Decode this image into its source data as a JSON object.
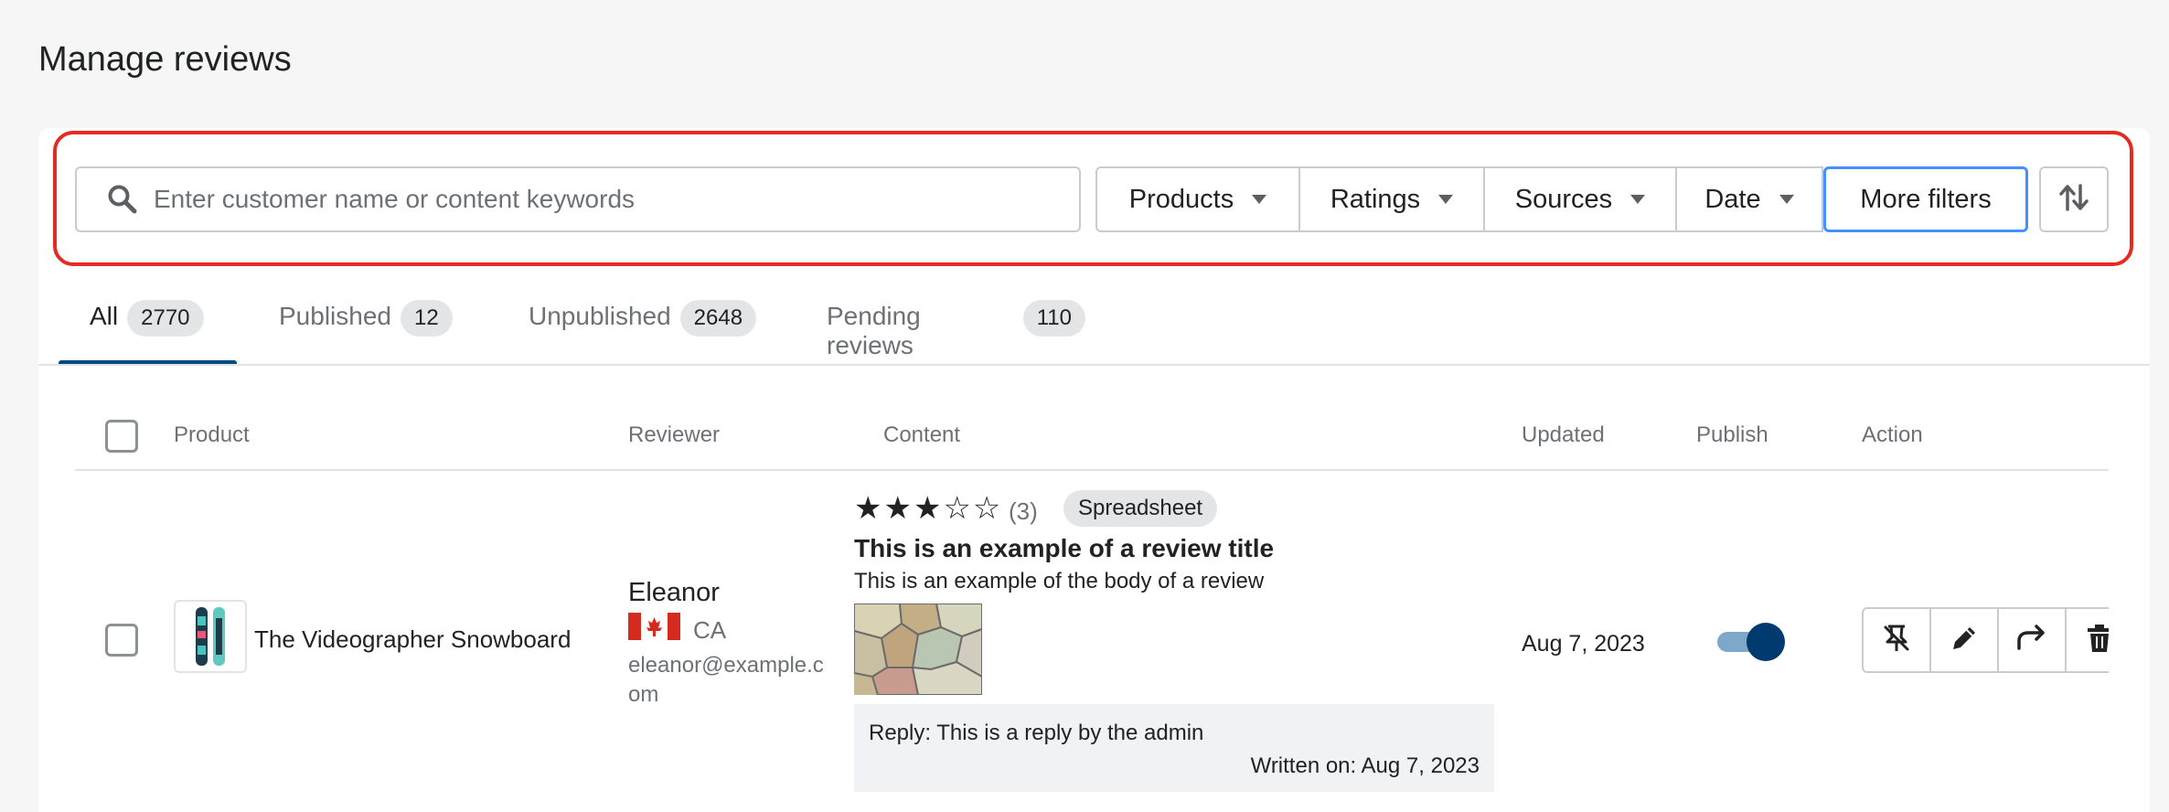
{
  "page": {
    "title": "Manage reviews"
  },
  "search": {
    "placeholder": "Enter customer name or content keywords"
  },
  "filters": {
    "products": "Products",
    "ratings": "Ratings",
    "sources": "Sources",
    "date": "Date",
    "more": "More filters"
  },
  "tabs": [
    {
      "label": "All",
      "count": "2770",
      "active": true
    },
    {
      "label": "Published",
      "count": "12"
    },
    {
      "label": "Unpublished",
      "count": "2648"
    },
    {
      "label": "Pending reviews",
      "count": "110"
    }
  ],
  "table": {
    "columns": [
      "Product",
      "Reviewer",
      "Content",
      "Updated",
      "Publish",
      "Action"
    ],
    "rows": [
      {
        "product": "The Videographer Snowboard",
        "reviewer": {
          "name": "Eleanor",
          "country": "CA",
          "email": "eleanor@example.com"
        },
        "rating_stars": "★★★☆☆",
        "rating_count": "(3)",
        "source": "Spreadsheet",
        "title": "This is an example of a review title",
        "body": "This is an example of the body of a review",
        "reply": "Reply: This is a reply by the admin",
        "reply_date": "Written on: Aug 7, 2023",
        "updated": "Aug 7, 2023",
        "published": true
      }
    ]
  },
  "icons": {
    "search": "search-icon",
    "caret": "caret-down-icon",
    "sort": "sort-icon",
    "flag": "canada-flag-icon",
    "pin": "unpin-icon",
    "edit": "pencil-icon",
    "reply": "reply-icon",
    "delete": "trash-icon"
  },
  "colors": {
    "accent": "#004c81",
    "highlight": "#e62a21",
    "focus": "#458fff",
    "toggle_knob": "#003a6f",
    "toggle_track": "#7fa7c9"
  }
}
